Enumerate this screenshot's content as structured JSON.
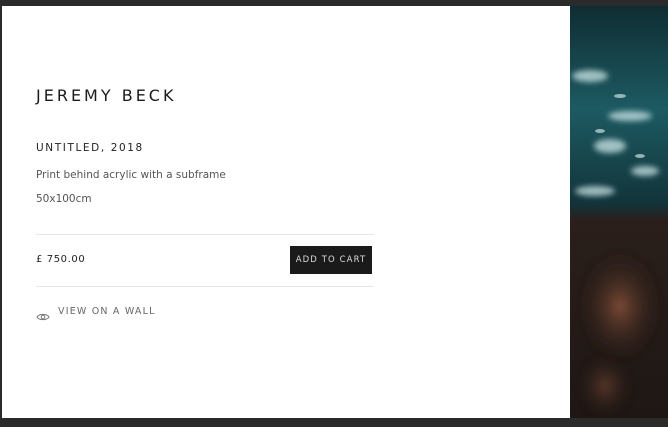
{
  "product": {
    "artist": "JEREMY BECK",
    "title": "UNTITLED, 2018",
    "description": "Print behind acrylic with a subframe",
    "size": "50x100cm",
    "price": "£ 750.00",
    "add_to_cart_label": "ADD TO CART",
    "view_on_wall_label": "VIEW ON A WALL"
  },
  "icons": {
    "view_on_wall": "eye-icon"
  },
  "colors": {
    "background": "#2b2b2b",
    "panel": "#ffffff",
    "button": "#1a1a1a",
    "ocean": "#1f5a5f"
  }
}
